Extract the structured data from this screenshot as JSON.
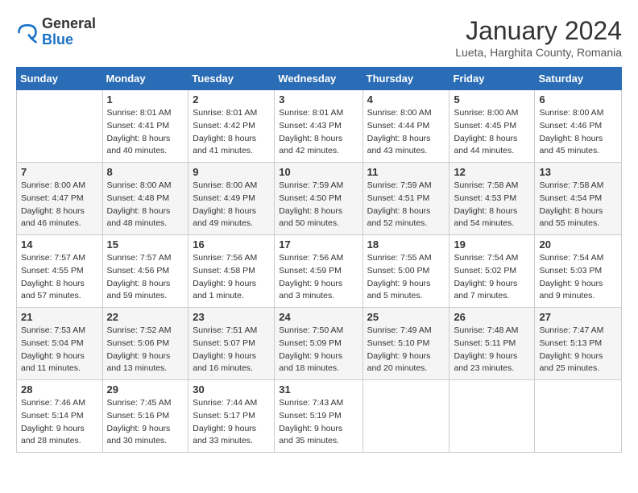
{
  "header": {
    "logo_general": "General",
    "logo_blue": "Blue",
    "month_title": "January 2024",
    "subtitle": "Lueta, Harghita County, Romania"
  },
  "days_of_week": [
    "Sunday",
    "Monday",
    "Tuesday",
    "Wednesday",
    "Thursday",
    "Friday",
    "Saturday"
  ],
  "weeks": [
    [
      {
        "day": "",
        "sunrise": "",
        "sunset": "",
        "daylight": ""
      },
      {
        "day": "1",
        "sunrise": "Sunrise: 8:01 AM",
        "sunset": "Sunset: 4:41 PM",
        "daylight": "Daylight: 8 hours and 40 minutes."
      },
      {
        "day": "2",
        "sunrise": "Sunrise: 8:01 AM",
        "sunset": "Sunset: 4:42 PM",
        "daylight": "Daylight: 8 hours and 41 minutes."
      },
      {
        "day": "3",
        "sunrise": "Sunrise: 8:01 AM",
        "sunset": "Sunset: 4:43 PM",
        "daylight": "Daylight: 8 hours and 42 minutes."
      },
      {
        "day": "4",
        "sunrise": "Sunrise: 8:00 AM",
        "sunset": "Sunset: 4:44 PM",
        "daylight": "Daylight: 8 hours and 43 minutes."
      },
      {
        "day": "5",
        "sunrise": "Sunrise: 8:00 AM",
        "sunset": "Sunset: 4:45 PM",
        "daylight": "Daylight: 8 hours and 44 minutes."
      },
      {
        "day": "6",
        "sunrise": "Sunrise: 8:00 AM",
        "sunset": "Sunset: 4:46 PM",
        "daylight": "Daylight: 8 hours and 45 minutes."
      }
    ],
    [
      {
        "day": "7",
        "sunrise": "Sunrise: 8:00 AM",
        "sunset": "Sunset: 4:47 PM",
        "daylight": "Daylight: 8 hours and 46 minutes."
      },
      {
        "day": "8",
        "sunrise": "Sunrise: 8:00 AM",
        "sunset": "Sunset: 4:48 PM",
        "daylight": "Daylight: 8 hours and 48 minutes."
      },
      {
        "day": "9",
        "sunrise": "Sunrise: 8:00 AM",
        "sunset": "Sunset: 4:49 PM",
        "daylight": "Daylight: 8 hours and 49 minutes."
      },
      {
        "day": "10",
        "sunrise": "Sunrise: 7:59 AM",
        "sunset": "Sunset: 4:50 PM",
        "daylight": "Daylight: 8 hours and 50 minutes."
      },
      {
        "day": "11",
        "sunrise": "Sunrise: 7:59 AM",
        "sunset": "Sunset: 4:51 PM",
        "daylight": "Daylight: 8 hours and 52 minutes."
      },
      {
        "day": "12",
        "sunrise": "Sunrise: 7:58 AM",
        "sunset": "Sunset: 4:53 PM",
        "daylight": "Daylight: 8 hours and 54 minutes."
      },
      {
        "day": "13",
        "sunrise": "Sunrise: 7:58 AM",
        "sunset": "Sunset: 4:54 PM",
        "daylight": "Daylight: 8 hours and 55 minutes."
      }
    ],
    [
      {
        "day": "14",
        "sunrise": "Sunrise: 7:57 AM",
        "sunset": "Sunset: 4:55 PM",
        "daylight": "Daylight: 8 hours and 57 minutes."
      },
      {
        "day": "15",
        "sunrise": "Sunrise: 7:57 AM",
        "sunset": "Sunset: 4:56 PM",
        "daylight": "Daylight: 8 hours and 59 minutes."
      },
      {
        "day": "16",
        "sunrise": "Sunrise: 7:56 AM",
        "sunset": "Sunset: 4:58 PM",
        "daylight": "Daylight: 9 hours and 1 minute."
      },
      {
        "day": "17",
        "sunrise": "Sunrise: 7:56 AM",
        "sunset": "Sunset: 4:59 PM",
        "daylight": "Daylight: 9 hours and 3 minutes."
      },
      {
        "day": "18",
        "sunrise": "Sunrise: 7:55 AM",
        "sunset": "Sunset: 5:00 PM",
        "daylight": "Daylight: 9 hours and 5 minutes."
      },
      {
        "day": "19",
        "sunrise": "Sunrise: 7:54 AM",
        "sunset": "Sunset: 5:02 PM",
        "daylight": "Daylight: 9 hours and 7 minutes."
      },
      {
        "day": "20",
        "sunrise": "Sunrise: 7:54 AM",
        "sunset": "Sunset: 5:03 PM",
        "daylight": "Daylight: 9 hours and 9 minutes."
      }
    ],
    [
      {
        "day": "21",
        "sunrise": "Sunrise: 7:53 AM",
        "sunset": "Sunset: 5:04 PM",
        "daylight": "Daylight: 9 hours and 11 minutes."
      },
      {
        "day": "22",
        "sunrise": "Sunrise: 7:52 AM",
        "sunset": "Sunset: 5:06 PM",
        "daylight": "Daylight: 9 hours and 13 minutes."
      },
      {
        "day": "23",
        "sunrise": "Sunrise: 7:51 AM",
        "sunset": "Sunset: 5:07 PM",
        "daylight": "Daylight: 9 hours and 16 minutes."
      },
      {
        "day": "24",
        "sunrise": "Sunrise: 7:50 AM",
        "sunset": "Sunset: 5:09 PM",
        "daylight": "Daylight: 9 hours and 18 minutes."
      },
      {
        "day": "25",
        "sunrise": "Sunrise: 7:49 AM",
        "sunset": "Sunset: 5:10 PM",
        "daylight": "Daylight: 9 hours and 20 minutes."
      },
      {
        "day": "26",
        "sunrise": "Sunrise: 7:48 AM",
        "sunset": "Sunset: 5:11 PM",
        "daylight": "Daylight: 9 hours and 23 minutes."
      },
      {
        "day": "27",
        "sunrise": "Sunrise: 7:47 AM",
        "sunset": "Sunset: 5:13 PM",
        "daylight": "Daylight: 9 hours and 25 minutes."
      }
    ],
    [
      {
        "day": "28",
        "sunrise": "Sunrise: 7:46 AM",
        "sunset": "Sunset: 5:14 PM",
        "daylight": "Daylight: 9 hours and 28 minutes."
      },
      {
        "day": "29",
        "sunrise": "Sunrise: 7:45 AM",
        "sunset": "Sunset: 5:16 PM",
        "daylight": "Daylight: 9 hours and 30 minutes."
      },
      {
        "day": "30",
        "sunrise": "Sunrise: 7:44 AM",
        "sunset": "Sunset: 5:17 PM",
        "daylight": "Daylight: 9 hours and 33 minutes."
      },
      {
        "day": "31",
        "sunrise": "Sunrise: 7:43 AM",
        "sunset": "Sunset: 5:19 PM",
        "daylight": "Daylight: 9 hours and 35 minutes."
      },
      {
        "day": "",
        "sunrise": "",
        "sunset": "",
        "daylight": ""
      },
      {
        "day": "",
        "sunrise": "",
        "sunset": "",
        "daylight": ""
      },
      {
        "day": "",
        "sunrise": "",
        "sunset": "",
        "daylight": ""
      }
    ]
  ]
}
